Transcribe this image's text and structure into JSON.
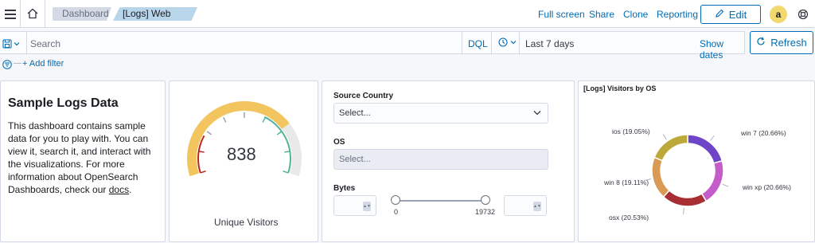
{
  "header": {
    "breadcrumbs": [
      "Dashboard",
      "[Logs] Web Traffic"
    ],
    "links": {
      "full_screen": "Full screen",
      "share": "Share",
      "clone": "Clone",
      "reporting": "Reporting"
    },
    "edit_label": "Edit",
    "avatar_initial": "a"
  },
  "query": {
    "search_placeholder": "Search",
    "language": "DQL",
    "time_range": "Last 7 days",
    "show_dates": "Show dates",
    "refresh_label": "Refresh"
  },
  "filters": {
    "add_label": "+ Add filter"
  },
  "markdown_panel": {
    "title": "Sample Logs Data",
    "body": "This dashboard contains sample data for you to play with. You can view it, search it, and interact with the visualizations. For more information about OpenSearch Dashboards, check our ",
    "link_text": "docs",
    "trailing": "."
  },
  "gauge_panel": {
    "value": "838",
    "label": "Unique Visitors"
  },
  "controls_panel": {
    "source_country_label": "Source Country",
    "source_country_placeholder": "Select...",
    "os_label": "OS",
    "os_placeholder": "Select...",
    "bytes_label": "Bytes",
    "bytes_min": "0",
    "bytes_max": "19732"
  },
  "chart_data": {
    "type": "pie",
    "title": "[Logs] Visitors by OS",
    "series": [
      {
        "label": "win 7 (20.66%)",
        "value": 20.66,
        "color": "#6f45c8"
      },
      {
        "label": "win xp (20.66%)",
        "value": 20.66,
        "color": "#c45cca"
      },
      {
        "label": "osx (20.53%)",
        "value": 20.53,
        "color": "#a72f34"
      },
      {
        "label": "win 8 (19.11%)",
        "value": 19.11,
        "color": "#d99a55"
      },
      {
        "label": "ios (19.05%)",
        "value": 19.05,
        "color": "#bda83a"
      }
    ]
  },
  "colors": {
    "accent": "#006bb4",
    "gauge_fill": "#f2c55f",
    "gauge_bg": "#e9e9e9"
  }
}
